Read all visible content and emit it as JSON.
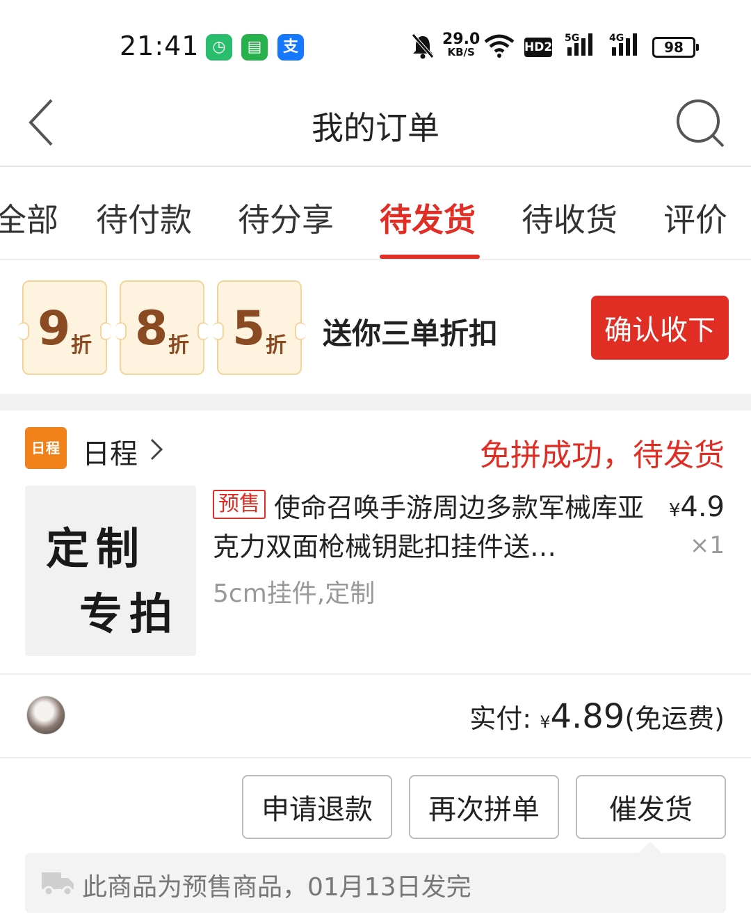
{
  "status_bar": {
    "time": "21:41",
    "speed_value": "29.0",
    "speed_unit": "KB/S",
    "hd": "HD2",
    "net1": "5G",
    "net2": "4G",
    "battery": "98",
    "apps": [
      "clock-app-icon",
      "message-app-icon",
      "alipay-app-icon"
    ]
  },
  "header": {
    "title": "我的订单"
  },
  "tabs": [
    {
      "label": "全部"
    },
    {
      "label": "待付款"
    },
    {
      "label": "待分享"
    },
    {
      "label": "待发货",
      "active": true
    },
    {
      "label": "待收货"
    },
    {
      "label": "评价"
    }
  ],
  "banner": {
    "coupons": [
      {
        "num": "9",
        "unit": "折"
      },
      {
        "num": "8",
        "unit": "折"
      },
      {
        "num": "5",
        "unit": "折"
      }
    ],
    "text": "送你三单折扣",
    "confirm_label": "确认收下"
  },
  "order": {
    "shop_logo": "日程",
    "shop_name": "日程",
    "status": "免拼成功，待发货",
    "image_line1": "定制",
    "image_line2": "专拍",
    "presale_tag": "预售",
    "title": "使命召唤手游周边多款军械库亚克力双面枪械钥匙扣挂件送…",
    "spec": "5cm挂件,定制",
    "price_currency": "¥",
    "price": "4.9",
    "qty": "×1",
    "paid_prefix": "实付:",
    "paid_currency": "¥",
    "paid_amount": "4.89",
    "paid_suffix": "(免运费)",
    "buttons": [
      "申请退款",
      "再次拼单",
      "催发货"
    ],
    "notice": "此商品为预售商品，01月13日发完"
  },
  "colors": {
    "accent": "#e02e24",
    "coupon_bg": "#fdf3df",
    "coupon_text": "#8a4a22",
    "shop_logo": "#f08219"
  }
}
